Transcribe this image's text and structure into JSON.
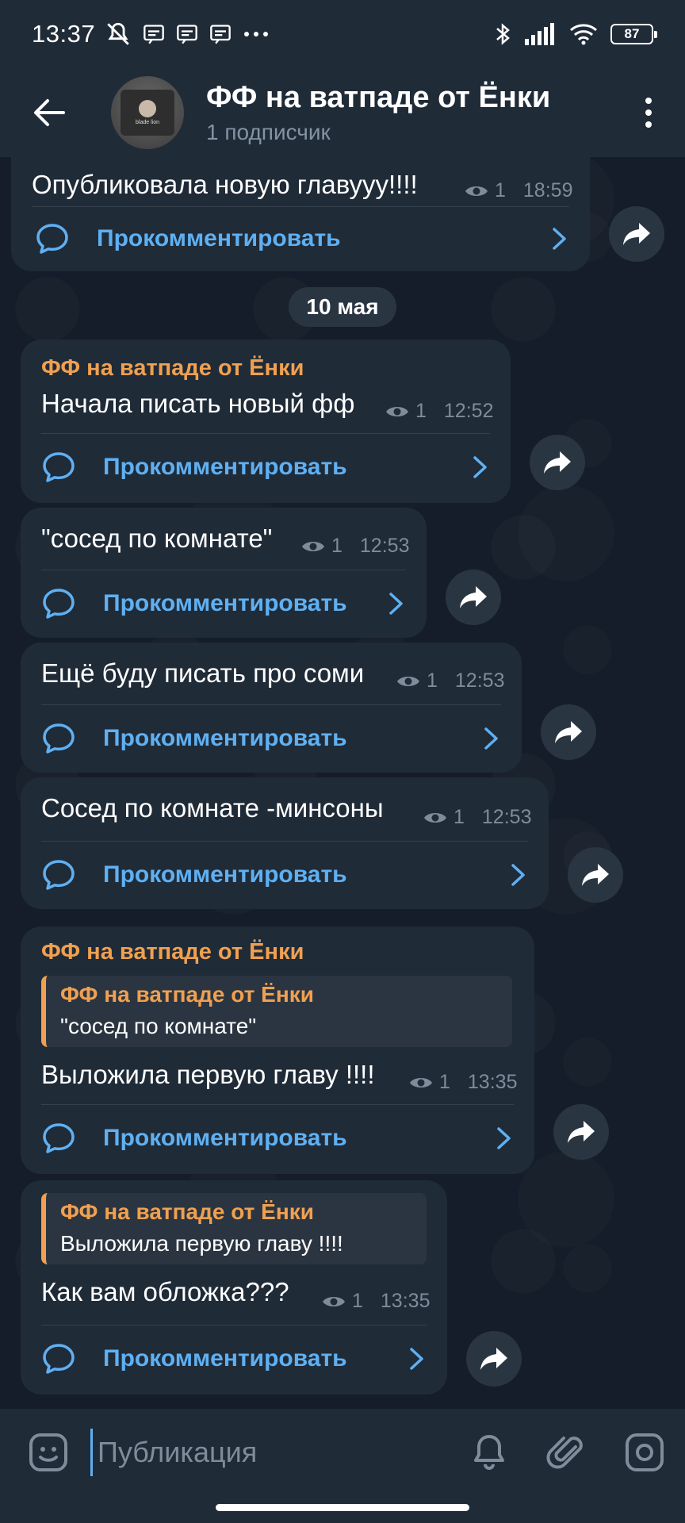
{
  "status_bar": {
    "time": "13:37",
    "battery": "87"
  },
  "header": {
    "title": "ФФ на ватпаде от Ёнки",
    "subtitle": "1 подписчик",
    "avatar_text": "blade lion"
  },
  "date_separator": "10 мая",
  "comment_label": "Прокомментировать",
  "posts": [
    {
      "text": "Опубликовала новую главууу!!!!",
      "views": "1",
      "time": "18:59"
    },
    {
      "author": "ФФ на ватпаде от Ёнки",
      "text": "Начала писать новый фф",
      "views": "1",
      "time": "12:52"
    },
    {
      "text": "\"сосед по комнате\"",
      "views": "1",
      "time": "12:53"
    },
    {
      "text": "Ещё буду писать про соми",
      "views": "1",
      "time": "12:53"
    },
    {
      "text": "Сосед по комнате -минсоны",
      "views": "1",
      "time": "12:53"
    },
    {
      "author": "ФФ на ватпаде от Ёнки",
      "reply_author": "ФФ на ватпаде от Ёнки",
      "reply_text": "\"сосед по комнате\"",
      "text": "Выложила первую главу !!!!",
      "views": "1",
      "time": "13:35"
    },
    {
      "reply_author": "ФФ на ватпаде от Ёнки",
      "reply_text": "Выложила первую главу !!!!",
      "text": "Как вам обложка???",
      "views": "1",
      "time": "13:35"
    }
  ],
  "composer": {
    "placeholder": "Публикация"
  },
  "colors": {
    "accent": "#5fb0f2",
    "author": "#f0a050",
    "bubble": "#202b38",
    "background": "#141d29"
  }
}
